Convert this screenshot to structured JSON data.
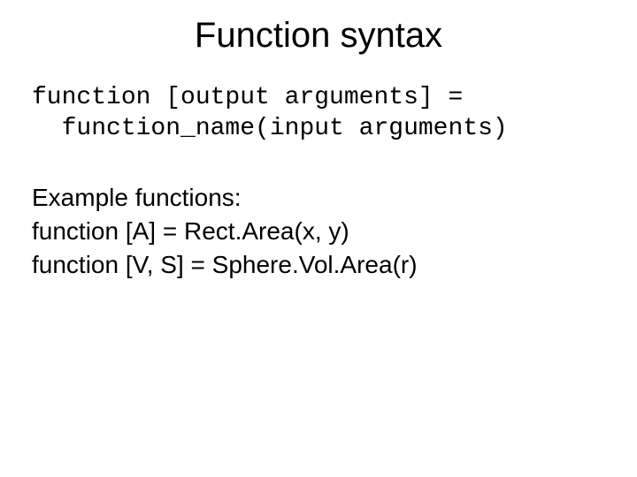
{
  "title": "Function syntax",
  "syntax": {
    "line1": "function [output arguments] =",
    "line2": "  function_name(input arguments)"
  },
  "examples": {
    "heading": "Example functions:",
    "line1": "function [A] = Rect.Area(x, y)",
    "line2": "function [V, S] = Sphere.Vol.Area(r)"
  }
}
